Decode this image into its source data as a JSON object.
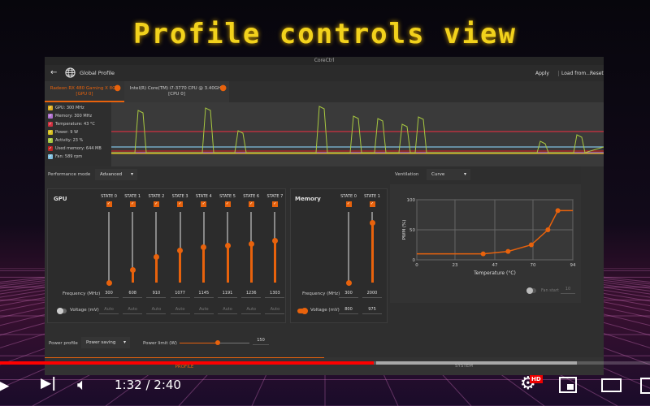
{
  "video_title": "Profile controls view",
  "window": {
    "title": "CoreCtrl",
    "profile_name": "Global Profile",
    "apply": "Apply",
    "load_from": "Load from...",
    "reset": "Reset"
  },
  "devices": [
    {
      "name": "Radeon RX 480 Gaming X 8GB",
      "sub": "[GPU 0]",
      "active": true
    },
    {
      "name": "Intel(R) Core(TM) i7-3770 CPU @ 3.40GHz",
      "sub": "[CPU 0]",
      "active": false
    }
  ],
  "sensors": [
    {
      "label": "GPU: 300 MHz",
      "color": "#e0b020"
    },
    {
      "label": "Memory: 300 MHz",
      "color": "#b070d0"
    },
    {
      "label": "Temperature: 43 °C",
      "color": "#d03040"
    },
    {
      "label": "Power: 9 W",
      "color": "#d8c020"
    },
    {
      "label": "Activity: 23 %",
      "color": "#a8c840"
    },
    {
      "label": "Used memory: 644 MB",
      "color": "#c02020"
    },
    {
      "label": "Fan: 589 rpm",
      "color": "#80c0e0"
    }
  ],
  "perf": {
    "label": "Performance mode",
    "value": "Advanced"
  },
  "gpu": {
    "title": "GPU",
    "freq_label": "Frequency (MHz)",
    "volt_label": "Voltage (mV)",
    "freq_min": 300,
    "freq_max": 2000,
    "states": [
      {
        "name": "STATE 0",
        "freq": "300",
        "volt": "Auto"
      },
      {
        "name": "STATE 1",
        "freq": "608",
        "volt": "Auto"
      },
      {
        "name": "STATE 2",
        "freq": "910",
        "volt": "Auto"
      },
      {
        "name": "STATE 3",
        "freq": "1077",
        "volt": "Auto"
      },
      {
        "name": "STATE 4",
        "freq": "1145",
        "volt": "Auto"
      },
      {
        "name": "STATE 5",
        "freq": "1191",
        "volt": "Auto"
      },
      {
        "name": "STATE 6",
        "freq": "1236",
        "volt": "Auto"
      },
      {
        "name": "STATE 7",
        "freq": "1303",
        "volt": "Auto"
      }
    ]
  },
  "memory": {
    "title": "Memory",
    "freq_label": "Frequency (MHz)",
    "volt_label": "Voltage (mV)",
    "freq_min": 300,
    "freq_max": 2300,
    "states": [
      {
        "name": "STATE 0",
        "freq": "300",
        "volt": "800"
      },
      {
        "name": "STATE 1",
        "freq": "2000",
        "volt": "975"
      }
    ]
  },
  "fan": {
    "label": "Ventilation",
    "mode": "Curve",
    "fan_start_label": "Fan start",
    "fan_start": "10"
  },
  "chart_data": {
    "type": "line",
    "title": "",
    "xlabel": "Temperature (°C)",
    "ylabel": "PWM (%)",
    "xlim": [
      0,
      94
    ],
    "ylim": [
      0,
      100
    ],
    "xticks": [
      "0",
      "23",
      "47",
      "70",
      "94"
    ],
    "yticks": [
      "0",
      "50",
      "100"
    ],
    "x": [
      0,
      40,
      55,
      69,
      79,
      85,
      94
    ],
    "y": [
      10,
      10,
      14,
      25,
      50,
      82,
      82
    ],
    "color": "#e8620c"
  },
  "power": {
    "profile_label": "Power profile",
    "profile_value": "Power saving",
    "limit_label": "Power limit (W)",
    "limit_value": "150",
    "limit_fraction": 0.55
  },
  "bottom_tabs": [
    "PROFILE",
    "SYSTEM"
  ],
  "player": {
    "time": "1:32 / 2:40",
    "progress": 0.575,
    "hd": "HD"
  }
}
